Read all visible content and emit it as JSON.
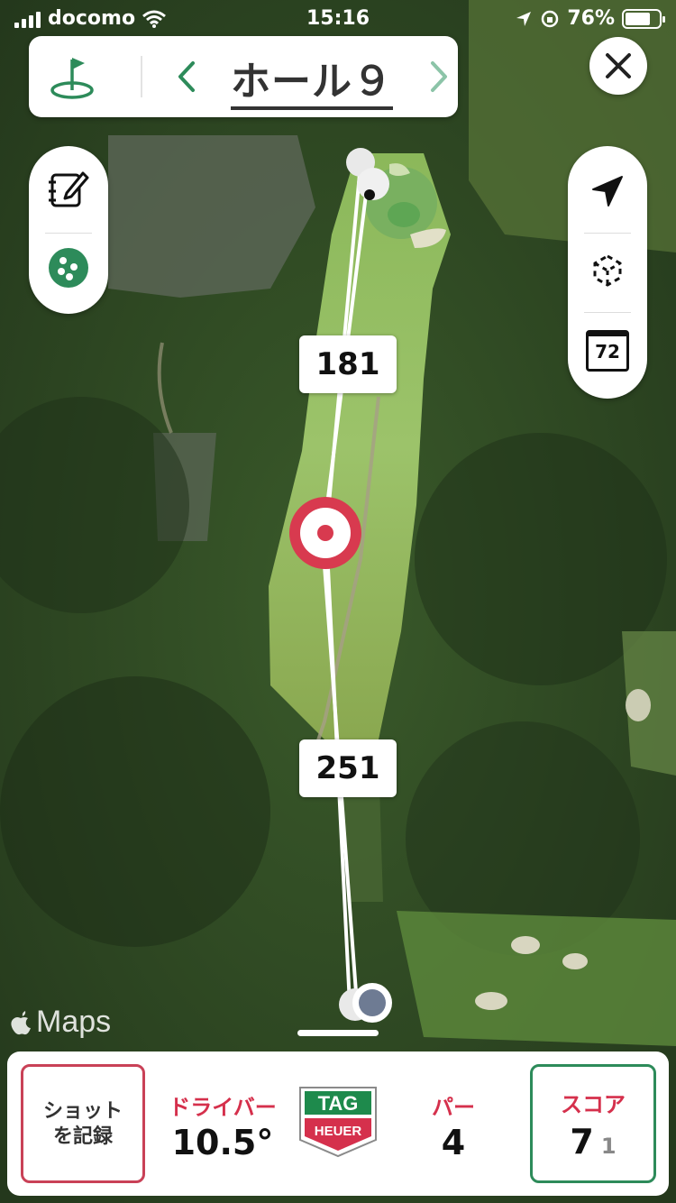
{
  "status_bar": {
    "carrier": "docomo",
    "time": "15:16",
    "battery": "76%",
    "battery_level": 0.76
  },
  "header": {
    "hole_title": "ホール９",
    "icons": {
      "flag": "golf-flag-icon",
      "prev": "chevron-left-icon",
      "next": "chevron-right-icon",
      "close": "close-icon"
    }
  },
  "left_tools": {
    "items": [
      "edit-scorecard-icon",
      "golf-balls-icon"
    ]
  },
  "right_tools": {
    "items": [
      "location-arrow-icon",
      "ar-view-icon",
      "par-calendar-icon"
    ],
    "par_icon_text": "72"
  },
  "map": {
    "distance_upper": "181",
    "distance_lower": "251",
    "attribution": "Maps"
  },
  "bottom_panel": {
    "record_shot_label": "ショット\nを記録",
    "club_label": "ドライバー",
    "club_value": "10.5°",
    "brand_text_top": "TAG",
    "brand_text_bottom": "HEUER",
    "par_label": "パー",
    "par_value": "4",
    "score_label": "スコア",
    "score_value": "7",
    "score_sub": "1"
  },
  "colors": {
    "accent_red": "#d5304c",
    "accent_green": "#2d8b5a",
    "target_red": "#d83a4f"
  }
}
